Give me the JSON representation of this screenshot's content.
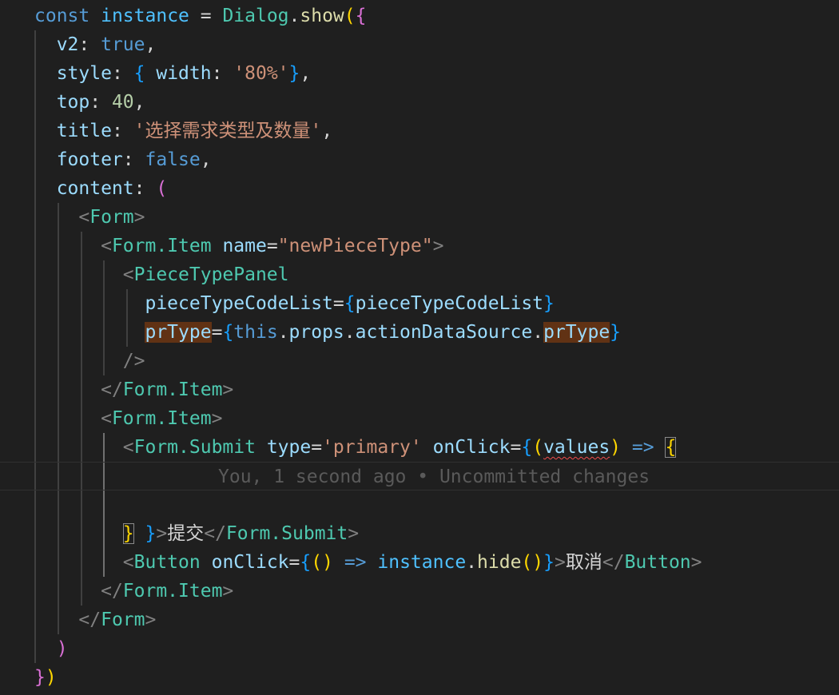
{
  "editor": {
    "colors": {
      "background": "#1f1f1f",
      "indent_guide": "#404040",
      "indent_guide_active": "#707070",
      "word_highlight": "#613214",
      "error_squiggle": "#f14c4c"
    },
    "blame": "You, 1 second ago • Uncommitted changes",
    "lines": [
      {
        "tokens": [
          [
            "const",
            "kw"
          ],
          [
            " ",
            "plain"
          ],
          [
            "instance",
            "var"
          ],
          [
            " = ",
            "plain"
          ],
          [
            "Dialog",
            "cls"
          ],
          [
            ".",
            "plain"
          ],
          [
            "show",
            "fn"
          ],
          [
            "(",
            "b1"
          ],
          [
            "{",
            "b2"
          ]
        ]
      },
      {
        "tokens": [
          [
            "  v2",
            "prop"
          ],
          [
            ": ",
            "plain"
          ],
          [
            "true",
            "kw"
          ],
          [
            ",",
            "plain"
          ]
        ]
      },
      {
        "tokens": [
          [
            "  style",
            "prop"
          ],
          [
            ": ",
            "plain"
          ],
          [
            "{",
            "b3"
          ],
          [
            " width",
            "prop"
          ],
          [
            ": ",
            "plain"
          ],
          [
            "'80%'",
            "str"
          ],
          [
            "}",
            "b3"
          ],
          [
            ",",
            "plain"
          ]
        ]
      },
      {
        "tokens": [
          [
            "  top",
            "prop"
          ],
          [
            ": ",
            "plain"
          ],
          [
            "40",
            "num"
          ],
          [
            ",",
            "plain"
          ]
        ]
      },
      {
        "tokens": [
          [
            "  title",
            "prop"
          ],
          [
            ": ",
            "plain"
          ],
          [
            "'选择需求类型及数量'",
            "str"
          ],
          [
            ",",
            "plain"
          ]
        ]
      },
      {
        "tokens": [
          [
            "  footer",
            "prop"
          ],
          [
            ": ",
            "plain"
          ],
          [
            "false",
            "kw"
          ],
          [
            ",",
            "plain"
          ]
        ]
      },
      {
        "tokens": [
          [
            "  content",
            "prop"
          ],
          [
            ": ",
            "plain"
          ],
          [
            "(",
            "b2"
          ]
        ]
      },
      {
        "tokens": [
          [
            "    ",
            "plain"
          ],
          [
            "<",
            "tag"
          ],
          [
            "Form",
            "cls"
          ],
          [
            ">",
            "tag"
          ]
        ]
      },
      {
        "tokens": [
          [
            "      ",
            "plain"
          ],
          [
            "<",
            "tag"
          ],
          [
            "Form.Item",
            "cls"
          ],
          [
            " ",
            "plain"
          ],
          [
            "name",
            "prop"
          ],
          [
            "=",
            "plain"
          ],
          [
            "\"newPieceType\"",
            "str"
          ],
          [
            ">",
            "tag"
          ]
        ]
      },
      {
        "tokens": [
          [
            "        ",
            "plain"
          ],
          [
            "<",
            "tag"
          ],
          [
            "PieceTypePanel",
            "cls"
          ]
        ]
      },
      {
        "tokens": [
          [
            "          ",
            "plain"
          ],
          [
            "pieceTypeCodeList",
            "prop"
          ],
          [
            "=",
            "plain"
          ],
          [
            "{",
            "b3"
          ],
          [
            "pieceTypeCodeList",
            "prop"
          ],
          [
            "}",
            "b3"
          ]
        ]
      },
      {
        "tokens": [
          [
            "          ",
            "plain"
          ],
          [
            "prType",
            "prop",
            "hl"
          ],
          [
            "=",
            "plain"
          ],
          [
            "{",
            "b3"
          ],
          [
            "this",
            "kw"
          ],
          [
            ".",
            "plain"
          ],
          [
            "props",
            "prop"
          ],
          [
            ".",
            "plain"
          ],
          [
            "actionDataSource",
            "prop"
          ],
          [
            ".",
            "plain"
          ],
          [
            "prType",
            "prop",
            "hl"
          ],
          [
            "}",
            "b3"
          ]
        ]
      },
      {
        "tokens": [
          [
            "        ",
            "plain"
          ],
          [
            "/>",
            "tag"
          ]
        ]
      },
      {
        "tokens": [
          [
            "      ",
            "plain"
          ],
          [
            "</",
            "tag"
          ],
          [
            "Form.Item",
            "cls"
          ],
          [
            ">",
            "tag"
          ]
        ]
      },
      {
        "tokens": [
          [
            "      ",
            "plain"
          ],
          [
            "<",
            "tag"
          ],
          [
            "Form.Item",
            "cls"
          ],
          [
            ">",
            "tag"
          ]
        ]
      },
      {
        "tokens": [
          [
            "        ",
            "plain"
          ],
          [
            "<",
            "tag"
          ],
          [
            "Form.Submit",
            "cls"
          ],
          [
            " ",
            "plain"
          ],
          [
            "type",
            "prop"
          ],
          [
            "=",
            "plain"
          ],
          [
            "'primary'",
            "str"
          ],
          [
            " ",
            "plain"
          ],
          [
            "onClick",
            "prop"
          ],
          [
            "=",
            "plain"
          ],
          [
            "{",
            "b3"
          ],
          [
            "(",
            "b1"
          ],
          [
            "values",
            "prop",
            "squiggle"
          ],
          [
            ")",
            "b1"
          ],
          [
            " ",
            "plain"
          ],
          [
            "=>",
            "kw"
          ],
          [
            " ",
            "plain"
          ],
          [
            "{",
            "b1",
            "box"
          ]
        ]
      },
      {
        "tokens": [],
        "blame": true,
        "current": true
      },
      {
        "tokens": []
      },
      {
        "tokens": [
          [
            "        ",
            "plain"
          ],
          [
            "}",
            "b1",
            "box"
          ],
          [
            " ",
            "plain"
          ],
          [
            "}",
            "b3"
          ],
          [
            ">",
            "tag"
          ],
          [
            "提交",
            "plain"
          ],
          [
            "</",
            "tag"
          ],
          [
            "Form.Submit",
            "cls"
          ],
          [
            ">",
            "tag"
          ]
        ]
      },
      {
        "tokens": [
          [
            "        ",
            "plain"
          ],
          [
            "<",
            "tag"
          ],
          [
            "Button",
            "cls"
          ],
          [
            " ",
            "plain"
          ],
          [
            "onClick",
            "prop"
          ],
          [
            "=",
            "plain"
          ],
          [
            "{",
            "b3"
          ],
          [
            "(",
            "b1"
          ],
          [
            ")",
            "b1"
          ],
          [
            " ",
            "plain"
          ],
          [
            "=>",
            "kw"
          ],
          [
            " ",
            "plain"
          ],
          [
            "instance",
            "var"
          ],
          [
            ".",
            "plain"
          ],
          [
            "hide",
            "fn"
          ],
          [
            "(",
            "b1"
          ],
          [
            ")",
            "b1"
          ],
          [
            "}",
            "b3"
          ],
          [
            ">",
            "tag"
          ],
          [
            "取消",
            "plain"
          ],
          [
            "</",
            "tag"
          ],
          [
            "Button",
            "cls"
          ],
          [
            ">",
            "tag"
          ]
        ]
      },
      {
        "tokens": [
          [
            "      ",
            "plain"
          ],
          [
            "</",
            "tag"
          ],
          [
            "Form.Item",
            "cls"
          ],
          [
            ">",
            "tag"
          ]
        ]
      },
      {
        "tokens": [
          [
            "    ",
            "plain"
          ],
          [
            "</",
            "tag"
          ],
          [
            "Form",
            "cls"
          ],
          [
            ">",
            "tag"
          ]
        ]
      },
      {
        "tokens": [
          [
            "  ",
            "plain"
          ],
          [
            ")",
            "b2"
          ]
        ]
      },
      {
        "tokens": [
          [
            "}",
            "b2"
          ],
          [
            ")",
            "b1"
          ]
        ]
      }
    ]
  }
}
